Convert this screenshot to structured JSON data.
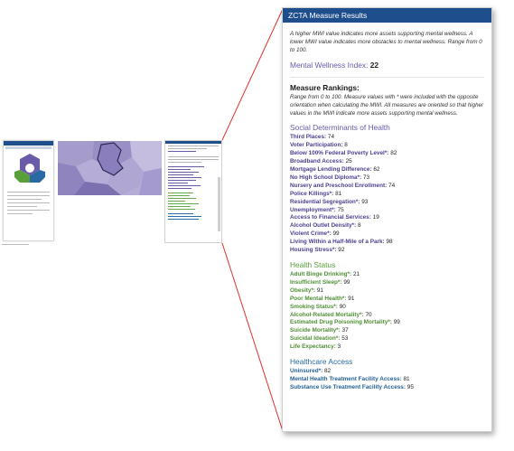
{
  "card": {
    "title": "ZCTA Measure Results",
    "intro": "A higher MWI value indicates more assets supporting mental wellness. A lower MWI value indicates more obstacles to mental wellness. Range from 0 to 100.",
    "mwi_label": "Mental Wellness Index:",
    "mwi_value": "22",
    "rankings_title": "Measure Rankings:",
    "rankings_desc": "Range from 0 to 100. Measure values with * were included with the opposite orientation when calculating the MWI. All measures are oriented so that higher values in the MWI indicate more assets supporting mental wellness."
  },
  "sections": {
    "sdoh": {
      "title": "Social Determinants of Health",
      "items": [
        {
          "label": "Third Places:",
          "value": "74"
        },
        {
          "label": "Voter Participation:",
          "value": "8"
        },
        {
          "label": "Below 100% Federal Poverty Level*:",
          "value": "82"
        },
        {
          "label": "Broadband Access:",
          "value": "25"
        },
        {
          "label": "Mortgage Lending Difference:",
          "value": "62"
        },
        {
          "label": "No High School Diploma*:",
          "value": "73"
        },
        {
          "label": "Nursery and Preschool Enrollment:",
          "value": "74"
        },
        {
          "label": "Police Killings*:",
          "value": "81"
        },
        {
          "label": "Residential Segregation*:",
          "value": "93"
        },
        {
          "label": "Unemployment*:",
          "value": "75"
        },
        {
          "label": "Access to Financial Services:",
          "value": "19"
        },
        {
          "label": "Alcohol Outlet Density*:",
          "value": "8"
        },
        {
          "label": "Violent Crime*:",
          "value": "99"
        },
        {
          "label": "Living Within a Half-Mile of a Park:",
          "value": "98"
        },
        {
          "label": "Housing Stress*:",
          "value": "92"
        }
      ]
    },
    "health": {
      "title": "Health Status",
      "items": [
        {
          "label": "Adult Binge Drinking*:",
          "value": "21"
        },
        {
          "label": "Insufficient Sleep*:",
          "value": "99"
        },
        {
          "label": "Obesity*:",
          "value": "91"
        },
        {
          "label": "Poor Mental Health*:",
          "value": "91"
        },
        {
          "label": "Smoking Status*:",
          "value": "90"
        },
        {
          "label": "Alcohol-Related Mortality*:",
          "value": "70"
        },
        {
          "label": "Estimated Drug Poisoning Mortality*:",
          "value": "99"
        },
        {
          "label": "Suicide Mortality*:",
          "value": "37"
        },
        {
          "label": "Suicidal Ideation*:",
          "value": "53"
        },
        {
          "label": "Life Expectancy:",
          "value": "3"
        }
      ]
    },
    "care": {
      "title": "Healthcare Access",
      "items": [
        {
          "label": "Uninsured*:",
          "value": "82"
        },
        {
          "label": "Mental Health Treatment Facility Access:",
          "value": "81"
        },
        {
          "label": "Substance Use Treatment Facility Access:",
          "value": "95"
        }
      ]
    }
  },
  "colors": {
    "header": "#1f4e8c",
    "sdoh": "#6a5aa8",
    "health": "#5a9a3a",
    "care": "#2a6aa4",
    "callout": "#e03030"
  }
}
